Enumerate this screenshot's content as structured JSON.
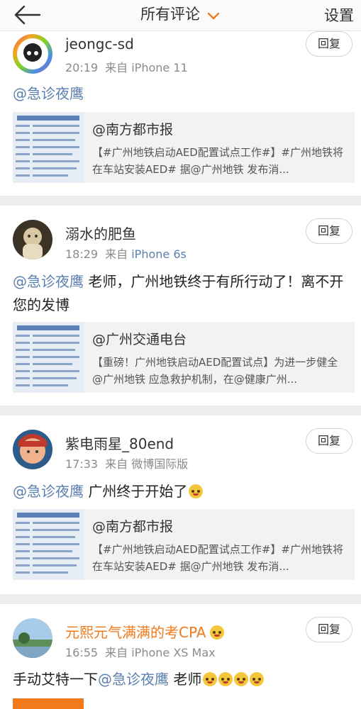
{
  "header": {
    "title": "所有评论",
    "settings_label": "设置",
    "accent": "#f07a1c"
  },
  "comments": [
    {
      "username": "jeongc-sd",
      "time": "20:19",
      "source_prefix": "来自",
      "source": "iPhone 11",
      "reply_label": "回复",
      "mention": "@急诊夜鹰",
      "text": "",
      "repost": {
        "title": "@南方都市报",
        "desc": "【#广州地铁启动AED配置试点工作#】#广州地铁将在车站安装AED# 据@广州地铁 发布消..."
      }
    },
    {
      "username": "溺水的肥鱼",
      "time": "18:29",
      "source_prefix": "来自",
      "source": "iPhone 6s",
      "reply_label": "回复",
      "mention": "@急诊夜鹰",
      "text": " 老师，广州地铁终于有所行动了！离不开您的发博",
      "repost": {
        "title": "@广州交通电台",
        "desc": "【重磅！广州地铁启动AED配置试点】为进一步健全@广州地铁 应急救护机制，在@健康广州..."
      }
    },
    {
      "username": "紫电雨星_80end",
      "time": "17:33",
      "source_prefix": "来自",
      "source": "微博国际版",
      "reply_label": "回复",
      "mention": "@急诊夜鹰",
      "text": " 广州终于开始了",
      "repost": {
        "title": "@南方都市报",
        "desc": "【#广州地铁启动AED配置试点工作#】#广州地铁将在车站安装AED# 据@广州地铁 发布消..."
      }
    },
    {
      "username": "元熙元气满满的考CPA",
      "time": "16:55",
      "source_prefix": "来自",
      "source": "iPhone XS Max",
      "reply_label": "回复",
      "text_prefix": "手动艾特一下",
      "mention": "@急诊夜鹰",
      "text": " 老师"
    }
  ]
}
